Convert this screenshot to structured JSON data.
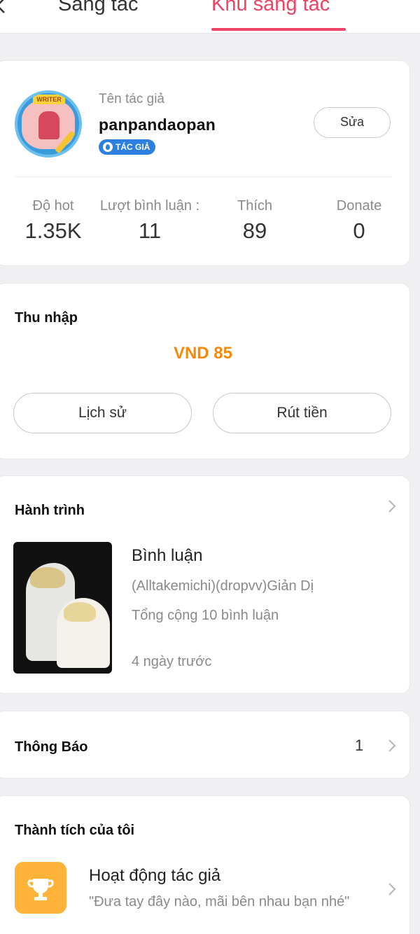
{
  "topbar": {
    "tabs": [
      {
        "label": "Sáng tác"
      },
      {
        "label": "Khu sáng tác"
      }
    ],
    "active_tab": "Khu sáng tác"
  },
  "profile": {
    "avatar_badge_text": "WRITER",
    "author_label": "Tên tác giả",
    "author_name": "panpandaopan",
    "badge": "TÁC GIẢ",
    "edit_label": "Sửa",
    "stats": [
      {
        "label": "Độ hot",
        "value": "1.35K"
      },
      {
        "label": "Lượt bình luận :",
        "value": "11"
      },
      {
        "label": "Thích",
        "value": "89"
      },
      {
        "label": "Donate",
        "value": "0"
      }
    ]
  },
  "income": {
    "title": "Thu nhập",
    "amount": "VND 85",
    "history_label": "Lịch sử",
    "withdraw_label": "Rút tiền"
  },
  "journey": {
    "title": "Hành trình",
    "item": {
      "type": "Bình luận",
      "story": "(Alltakemichi)(dropvv)Giản Dị",
      "total": "Tổng cộng 10 bình luận",
      "time": "4 ngày trước"
    }
  },
  "notifications": {
    "title": "Thông Báo",
    "count": "1"
  },
  "achievements": {
    "title": "Thành tích của tôi",
    "item": {
      "icon": "trophy-icon",
      "name": "Hoạt động tác giả",
      "description": "\"Đưa tay đây nào, mãi bên nhau bạn nhé\""
    }
  },
  "colors": {
    "accent": "#ee4466",
    "income": "#f58a0a",
    "badge": "#2d7fe0",
    "trophy_bg": "#ffb338"
  }
}
